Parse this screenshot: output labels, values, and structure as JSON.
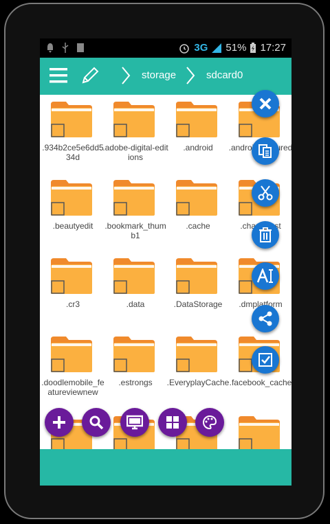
{
  "status": {
    "network": "3G",
    "battery": "51%",
    "time": "17:27"
  },
  "toolbar": {
    "crumbs": [
      "storage",
      "sdcard0"
    ]
  },
  "folders": [
    {
      "name": ".934b2ce5e6dd534d"
    },
    {
      "name": ".adobe-digital-editions"
    },
    {
      "name": ".android"
    },
    {
      "name": ".android_secured"
    },
    {
      "name": ".beautyedit"
    },
    {
      "name": ".bookmark_thumb1"
    },
    {
      "name": ".cache"
    },
    {
      "name": ".chartboost"
    },
    {
      "name": ".cr3"
    },
    {
      "name": ".data"
    },
    {
      "name": ".DataStorage"
    },
    {
      "name": ".dmplatform"
    },
    {
      "name": ".doodlemobile_featureviewnew"
    },
    {
      "name": ".estrongs"
    },
    {
      "name": ".EveryplayCache"
    },
    {
      "name": ".facebook_cache"
    },
    {
      "name": ""
    },
    {
      "name": ""
    },
    {
      "name": ""
    },
    {
      "name": ""
    }
  ],
  "right_actions": [
    "close-icon",
    "copy-icon",
    "cut-icon",
    "delete-icon",
    "rename-icon",
    "share-icon",
    "select-all-icon"
  ],
  "bottom_actions": [
    "add-icon",
    "search-icon",
    "screen-icon",
    "grid-view-icon",
    "theme-icon"
  ],
  "colors": {
    "accent": "#26b8a5",
    "folder": "#fbb040",
    "folder_tab": "#f08a2c",
    "blue_fab": "#1976d2",
    "purple_fab": "#6a1b9a"
  }
}
